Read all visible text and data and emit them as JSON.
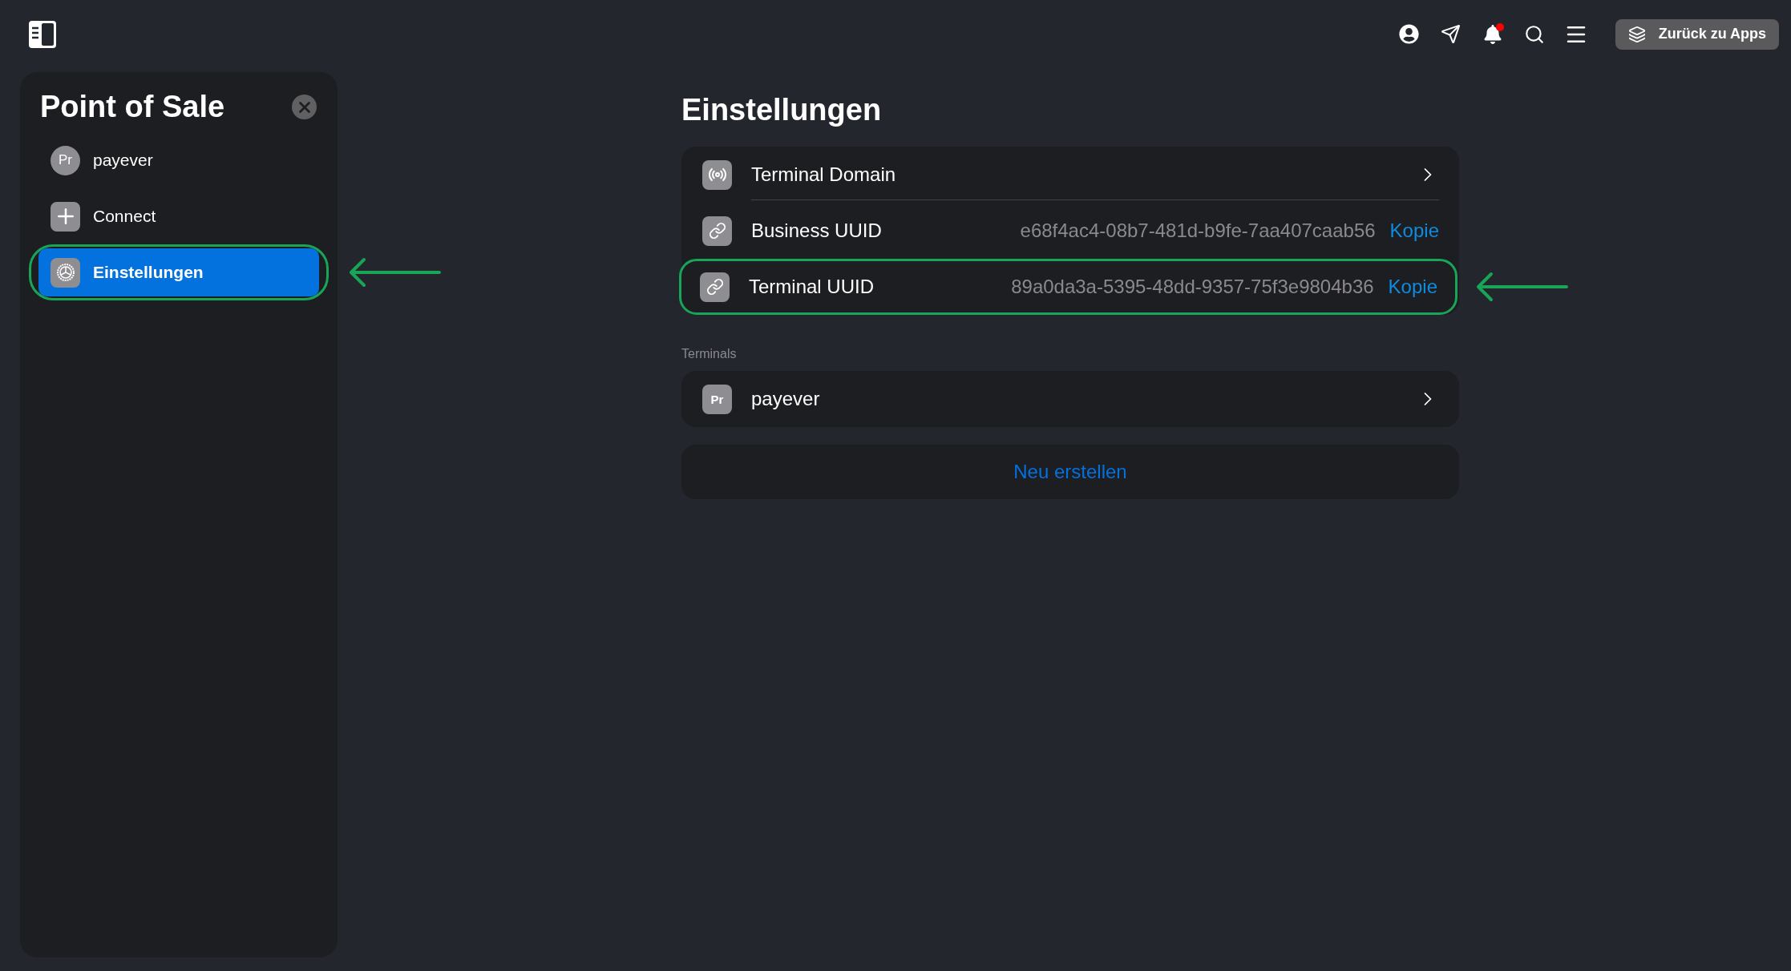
{
  "topbar": {
    "notifications_unread": true,
    "back_button": "Zurück zu Apps"
  },
  "sidebar": {
    "title": "Point of Sale",
    "items": [
      {
        "kind": "avatar",
        "avatar": "Pr",
        "label": "payever",
        "selected": false,
        "highlighted": false
      },
      {
        "kind": "plus",
        "label": "Connect",
        "selected": false,
        "highlighted": false
      },
      {
        "kind": "settings",
        "label": "Einstellungen",
        "selected": true,
        "highlighted": true
      }
    ]
  },
  "main": {
    "title": "Einstellungen",
    "settings": [
      {
        "kind": "domain",
        "label": "Terminal Domain",
        "highlighted": false
      },
      {
        "kind": "uuid",
        "label": "Business UUID",
        "value": "e68f4ac4-08b7-481d-b9fe-7aa407caab56",
        "action": "Kopie",
        "highlighted": false
      },
      {
        "kind": "uuid",
        "label": "Terminal UUID",
        "value": "89a0da3a-5395-48dd-9357-75f3e9804b36",
        "action": "Kopie",
        "highlighted": true
      }
    ],
    "terminals": {
      "heading": "Terminals",
      "items": [
        {
          "avatar": "Pr",
          "label": "payever"
        }
      ]
    },
    "create_button": "Neu erstellen"
  }
}
